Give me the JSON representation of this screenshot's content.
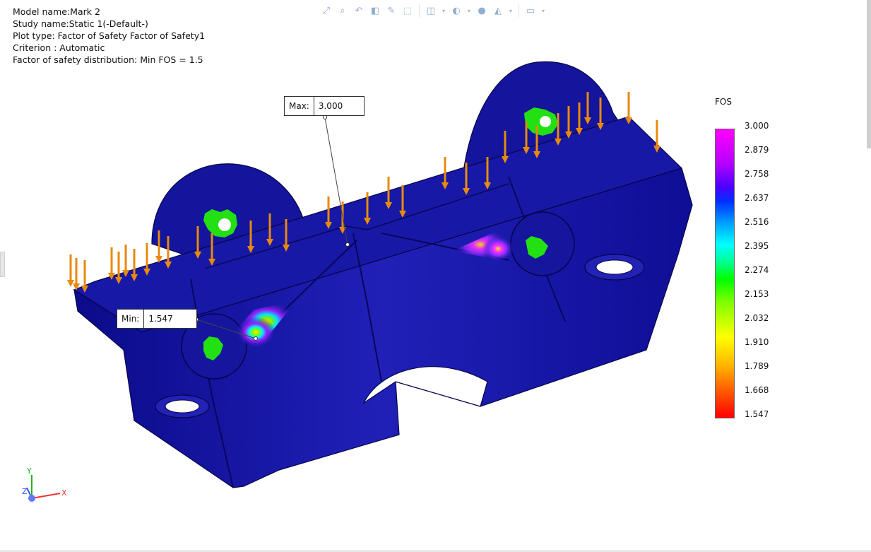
{
  "study_info": {
    "model_name": "Model name:Mark 2",
    "study_name": "Study name:Static 1(-Default-)",
    "plot_type": "Plot type: Factor of Safety Factor of Safety1",
    "criterion": "Criterion : Automatic",
    "distribution": "Factor of safety distribution: Min FOS =  1.5"
  },
  "toolbar": {
    "icons": [
      "zoom-to-fit-icon",
      "zoom-area-icon",
      "previous-view-icon",
      "section-view-icon",
      "dynamic-annotation-icon",
      "view-orientation-icon",
      "display-style-icon",
      "hide-show-icon",
      "edit-appearance-icon",
      "apply-scene-icon",
      "view-settings-icon"
    ]
  },
  "probes": {
    "max": {
      "label": "Max:",
      "value": "3.000"
    },
    "min": {
      "label": "Min:",
      "value": "1.547"
    }
  },
  "legend": {
    "title": "FOS",
    "ticks": [
      "3.000",
      "2.879",
      "2.758",
      "2.637",
      "2.516",
      "2.395",
      "2.274",
      "2.153",
      "2.032",
      "1.910",
      "1.789",
      "1.668",
      "1.547"
    ],
    "top_color": "#ff00ff",
    "bottom_color": "#ff0000"
  },
  "triad": {
    "x": "X",
    "y": "Y",
    "z": "Z"
  },
  "colors": {
    "model_body": "#1a1aa8",
    "load_arrows": "#e88a0e",
    "fixture_marks": "#22e011"
  }
}
